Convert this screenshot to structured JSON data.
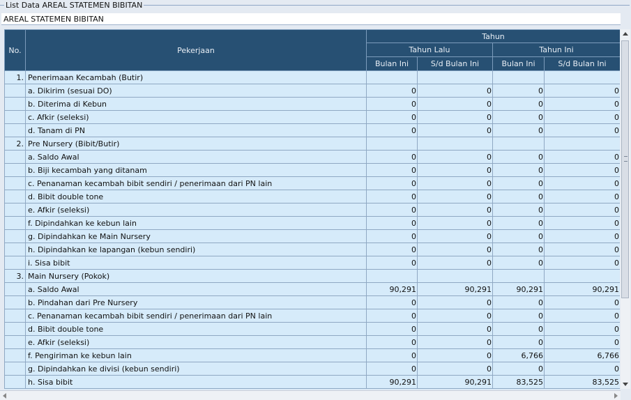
{
  "panel": {
    "legend": "List Data AREAL STATEMEN BIBITAN",
    "subtitle": "AREAL STATEMEN BIBITAN"
  },
  "header": {
    "no": "No.",
    "pekerjaan": "Pekerjaan",
    "tahun": "Tahun",
    "tahun_lalu": "Tahun Lalu",
    "tahun_ini": "Tahun Ini",
    "bulan_ini": "Bulan Ini",
    "sd_bulan_ini": "S/d Bulan Ini"
  },
  "rows": [
    {
      "no": "1.",
      "label": "Penerimaan Kecambah (Butir)",
      "values": [
        "",
        "",
        "",
        ""
      ]
    },
    {
      "no": "",
      "label": "a. Dikirim (sesuai DO)",
      "values": [
        "0",
        "0",
        "0",
        "0"
      ]
    },
    {
      "no": "",
      "label": "b. Diterima di Kebun",
      "values": [
        "0",
        "0",
        "0",
        "0"
      ]
    },
    {
      "no": "",
      "label": "c. Afkir (seleksi)",
      "values": [
        "0",
        "0",
        "0",
        "0"
      ]
    },
    {
      "no": "",
      "label": "d. Tanam di PN",
      "values": [
        "0",
        "0",
        "0",
        "0"
      ]
    },
    {
      "no": "2.",
      "label": "Pre Nursery (Bibit/Butir)",
      "values": [
        "",
        "",
        "",
        ""
      ]
    },
    {
      "no": "",
      "label": "a. Saldo Awal",
      "values": [
        "0",
        "0",
        "0",
        "0"
      ]
    },
    {
      "no": "",
      "label": "b. Biji kecambah yang ditanam",
      "values": [
        "0",
        "0",
        "0",
        "0"
      ]
    },
    {
      "no": "",
      "label": "c. Penanaman kecambah bibit sendiri / penerimaan dari PN lain",
      "values": [
        "0",
        "0",
        "0",
        "0"
      ]
    },
    {
      "no": "",
      "label": "d. Bibit double tone",
      "values": [
        "0",
        "0",
        "0",
        "0"
      ]
    },
    {
      "no": "",
      "label": "e. Afkir (seleksi)",
      "values": [
        "0",
        "0",
        "0",
        "0"
      ]
    },
    {
      "no": "",
      "label": "f. Dipindahkan ke kebun lain",
      "values": [
        "0",
        "0",
        "0",
        "0"
      ]
    },
    {
      "no": "",
      "label": "g. Dipindahkan ke Main Nursery",
      "values": [
        "0",
        "0",
        "0",
        "0"
      ]
    },
    {
      "no": "",
      "label": "h. Dipindahkan ke lapangan (kebun sendiri)",
      "values": [
        "0",
        "0",
        "0",
        "0"
      ]
    },
    {
      "no": "",
      "label": "i. Sisa bibit",
      "values": [
        "0",
        "0",
        "0",
        "0"
      ]
    },
    {
      "no": "3.",
      "label": "Main Nursery (Pokok)",
      "values": [
        "",
        "",
        "",
        ""
      ]
    },
    {
      "no": "",
      "label": "a. Saldo Awal",
      "values": [
        "90,291",
        "90,291",
        "90,291",
        "90,291"
      ]
    },
    {
      "no": "",
      "label": "b. Pindahan dari Pre Nursery",
      "values": [
        "0",
        "0",
        "0",
        "0"
      ]
    },
    {
      "no": "",
      "label": "c. Penanaman kecambah bibit sendiri / penerimaan dari PN lain",
      "values": [
        "0",
        "0",
        "0",
        "0"
      ]
    },
    {
      "no": "",
      "label": "d. Bibit double tone",
      "values": [
        "0",
        "0",
        "0",
        "0"
      ]
    },
    {
      "no": "",
      "label": "e. Afkir (seleksi)",
      "values": [
        "0",
        "0",
        "0",
        "0"
      ]
    },
    {
      "no": "",
      "label": "f. Pengiriman ke kebun lain",
      "values": [
        "0",
        "0",
        "6,766",
        "6,766"
      ]
    },
    {
      "no": "",
      "label": "g. Dipindahkan ke divisi (kebun sendiri)",
      "values": [
        "0",
        "0",
        "0",
        "0"
      ]
    },
    {
      "no": "",
      "label": "h. Sisa bibit",
      "values": [
        "90,291",
        "90,291",
        "83,525",
        "83,525"
      ]
    }
  ]
}
